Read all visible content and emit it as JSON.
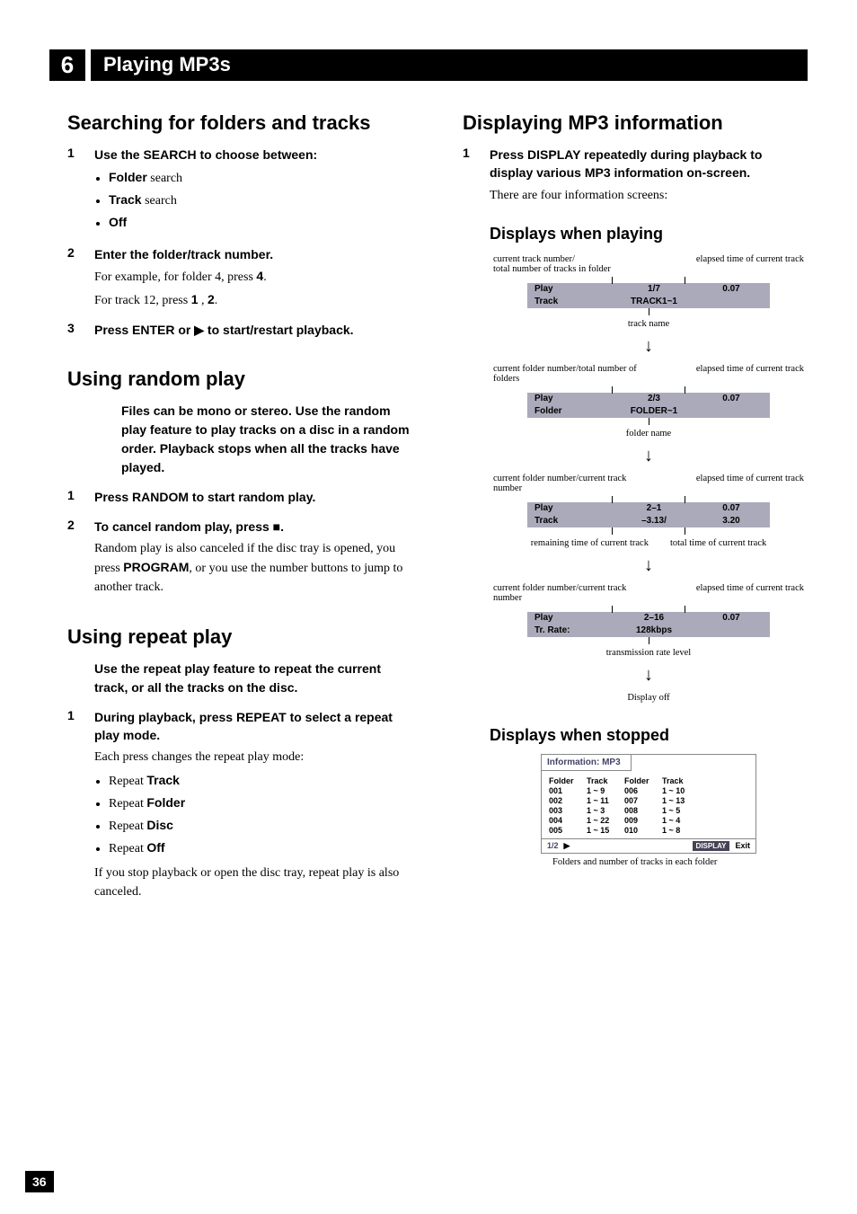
{
  "chapter": {
    "num": "6",
    "title": "Playing MP3s"
  },
  "pageNumber": "36",
  "left": {
    "h1": "Searching for folders and tracks",
    "s1": {
      "lead": "Use the SEARCH to choose between:",
      "b1a": "Folder",
      "b1b": "search",
      "b2a": "Track",
      "b2b": "search",
      "b3": "Off"
    },
    "s2": {
      "lead": "Enter the folder/track number.",
      "l1a": "For example, for folder 4, press ",
      "l1b": "4",
      "l1c": ".",
      "l2a": "For track 12, press ",
      "l2b": "1",
      "l2c": " , ",
      "l2d": "2",
      "l2e": "."
    },
    "s3": {
      "leadA": "Press ENTER or ",
      "play": "▶",
      "leadB": " to start/restart playback."
    },
    "random": {
      "h": "Using random play",
      "intro": "Files can be mono or stereo. Use the random play feature to play tracks on a disc in a random order. Playback stops when all the tracks have played.",
      "s1": "Press RANDOM to start random play.",
      "s2lead": "To cancel random play, press ",
      "stop": "■",
      "dot": ".",
      "s2b1": "Random play is also canceled if the disc tray is opened, you press ",
      "s2b2": "PROGRAM",
      "s2b3": ", or you use the number buttons to jump to another track."
    },
    "repeat": {
      "h": "Using repeat play",
      "intro": "Use the repeat play feature to repeat the current track, or all the tracks on the disc.",
      "s1": "During playback, press REPEAT to select a repeat play mode.",
      "s1b": "Each press changes the repeat play mode:",
      "b1a": "Repeat ",
      "b1b": "Track",
      "b2a": "Repeat ",
      "b2b": "Folder",
      "b3a": "Repeat ",
      "b3b": "Disc",
      "b4a": "Repeat ",
      "b4b": "Off",
      "tail": "If you stop playback or open the disc tray, repeat play is also canceled."
    }
  },
  "right": {
    "h1": "Displaying MP3 information",
    "s1": {
      "lead": "Press DISPLAY repeatedly during playback to display various MP3 information on-screen.",
      "body": "There are four information screens:"
    },
    "hPlaying": "Displays when playing",
    "d1": {
      "tl": "current track number/\ntotal number of tracks in folder",
      "tr": "elapsed time of current track",
      "r1a": "Play",
      "r1b": "1/7",
      "r1c": "0.07",
      "r2a": "Track",
      "r2b": "TRACK1~1",
      "cap": "track name"
    },
    "d2": {
      "tl": "current folder number/total number of folders",
      "tr": "elapsed time of current track",
      "r1a": "Play",
      "r1b": "2/3",
      "r1c": "0.07",
      "r2a": "Folder",
      "r2b": "FOLDER~1",
      "cap": "folder name"
    },
    "d3": {
      "tl": "current folder number/current track number",
      "tr": "elapsed time of current track",
      "r1a": "Play",
      "r1b": "2–1",
      "r1c": "0.07",
      "r2a": "Track",
      "r2b": "–3.13/",
      "r2c": "3.20",
      "capL": "remaining time of current track",
      "capR": "total time of current track"
    },
    "d4": {
      "tl": "current folder number/current track number",
      "tr": "elapsed time of current track",
      "r1a": "Play",
      "r1b": "2–16",
      "r1c": "0.07",
      "r2a": "Tr. Rate:",
      "r2b": "128kbps",
      "cap": "transmission rate level",
      "off": "Display off"
    },
    "hStopped": "Displays when stopped",
    "info": {
      "head": "Information: MP3",
      "h1": "Folder",
      "h2": "Track",
      "h3": "Folder",
      "h4": "Track",
      "r": [
        [
          "001",
          "1 ~ 9",
          "006",
          "1 ~ 10"
        ],
        [
          "002",
          "1 ~ 11",
          "007",
          "1 ~ 13"
        ],
        [
          "003",
          "1 ~ 3",
          "008",
          "1 ~ 5"
        ],
        [
          "004",
          "1 ~ 22",
          "009",
          "1 ~ 4"
        ],
        [
          "005",
          "1 ~ 15",
          "010",
          "1 ~ 8"
        ]
      ],
      "page": "1/2",
      "play": "▶",
      "disp": "DISPLAY",
      "exit": "Exit",
      "cap": "Folders and number of tracks in each folder"
    }
  }
}
